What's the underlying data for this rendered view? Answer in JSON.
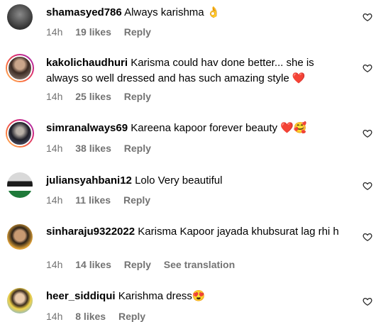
{
  "comments": [
    {
      "username": "shamasyed786",
      "text": "Always karishma 👌",
      "time": "14h",
      "likes": "19 likes",
      "reply": "Reply",
      "translation": ""
    },
    {
      "username": "kakolichaudhuri",
      "text": "Karisma could hav done better... she is always so well dressed and has such amazing style ❤️",
      "time": "14h",
      "likes": "25 likes",
      "reply": "Reply",
      "translation": ""
    },
    {
      "username": "simranalways69",
      "text": "Kareena kapoor forever beauty ❤️🥰",
      "time": "14h",
      "likes": "38 likes",
      "reply": "Reply",
      "translation": ""
    },
    {
      "username": "juliansyahbani12",
      "text": "Lolo Very beautiful",
      "time": "14h",
      "likes": "11 likes",
      "reply": "Reply",
      "translation": ""
    },
    {
      "username": "sinharaju9322022",
      "text": "Karisma Kapoor jayada khubsurat lag rhi h",
      "time": "14h",
      "likes": "14 likes",
      "reply": "Reply",
      "translation": "See translation"
    },
    {
      "username": "heer_siddiqui",
      "text": "Karishma dress😍",
      "time": "14h",
      "likes": "8 likes",
      "reply": "Reply",
      "translation": ""
    }
  ],
  "colors": {
    "accent_ring": "#d62976",
    "meta_text": "#737373"
  },
  "icons": {
    "like": "heart-outline-icon"
  }
}
